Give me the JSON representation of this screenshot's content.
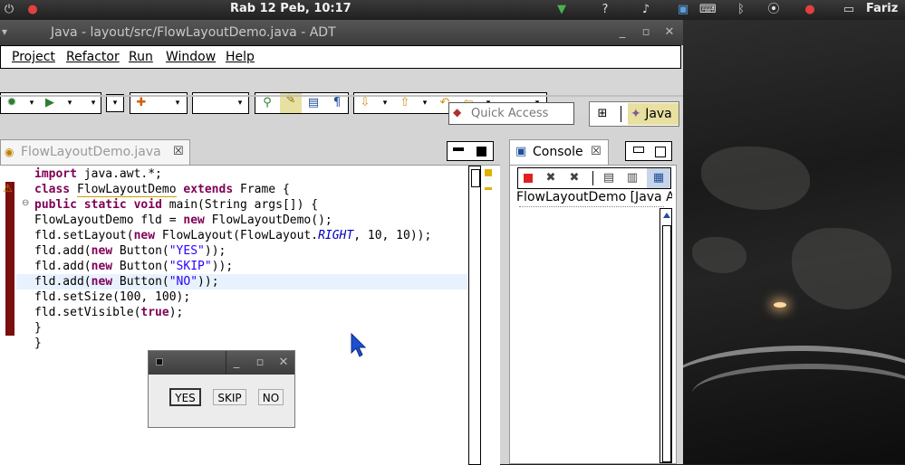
{
  "panel": {
    "clock": "Rab 12 Peb, 10:17",
    "user": "Fariz"
  },
  "window": {
    "title": "Java - layout/src/FlowLayoutDemo.java - ADT",
    "menus": [
      "Project",
      "Refactor",
      "Run",
      "Window",
      "Help"
    ]
  },
  "toolbar": {
    "quick_access_placeholder": "Quick Access",
    "perspective_label": "Java"
  },
  "editor": {
    "tab_label": "FlowLayoutDemo.java"
  },
  "console": {
    "tab_label": "Console",
    "header": "FlowLayoutDemo [Java Ap"
  },
  "dialog": {
    "buttons": [
      "YES",
      "SKIP",
      "NO"
    ]
  },
  "code_lines": [
    "import java.awt.*;",
    "class FlowLayoutDemo extends Frame {",
    "public static void main(String args[]) {",
    "FlowLayoutDemo fld = new FlowLayoutDemo();",
    "fld.setLayout(new FlowLayout(FlowLayout.RIGHT, 10, 10));",
    "fld.add(new Button(\"YES\"));",
    "fld.add(new Button(\"SKIP\"));",
    "fld.add(new Button(\"NO\"));",
    "fld.setSize(100, 100);",
    "fld.setVisible(true);",
    "}",
    "}"
  ],
  "colors": {
    "keyword": "#7f0055",
    "string": "#2a00ff",
    "constant": "#0000c0",
    "error_bar": "#7a0e0e"
  }
}
